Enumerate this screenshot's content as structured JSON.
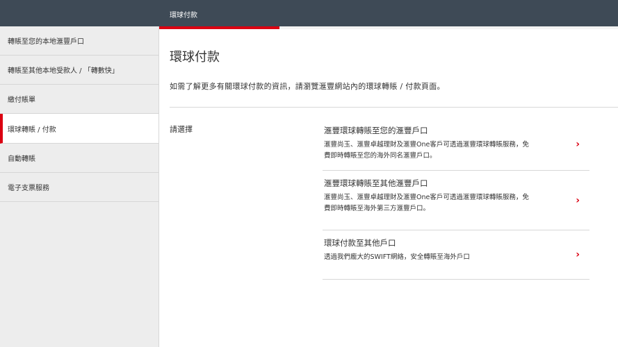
{
  "header": {
    "title": "環球付款"
  },
  "sidebar": {
    "items": [
      {
        "label": "轉賬至您的本地滙豐戶口"
      },
      {
        "label": "轉賬至其他本地受款人 / 「轉數快」"
      },
      {
        "label": "繳付賬單"
      },
      {
        "label": "環球轉賬 / 付款",
        "active": true
      },
      {
        "label": "自動轉賬"
      },
      {
        "label": "電子支票服務"
      }
    ]
  },
  "main": {
    "title": "環球付款",
    "intro": "如需了解更多有關環球付款的資訊，請瀏覽滙豐網站內的環球轉賬 / 付款頁面。",
    "choose_label": "請選擇",
    "options": [
      {
        "title": "滙豐環球轉賬至您的滙豐戶口",
        "desc_line1": "滙豐尚玉、滙豐卓越理財及滙豐One客戶可透過滙豐環球轉賬服務，免",
        "desc_line2": "費即時轉賬至您的海外同名滙豐戶口。"
      },
      {
        "title": "滙豐環球轉賬至其他滙豐戶口",
        "desc_line1": "滙豐尚玉、滙豐卓越理財及滙豐One客戶可透過滙豐環球轉賬服務，免",
        "desc_line2": "費即時轉賬至海外第三方滙豐戶口。"
      },
      {
        "title": "環球付款至其他戶口",
        "desc_line1": "透過我們龐大的SWIFT網絡，安全轉賬至海外戶口",
        "desc_line2": ""
      }
    ]
  },
  "colors": {
    "header_bg": "#3e4a56",
    "accent": "#db0011",
    "sidebar_bg": "#ededed"
  },
  "icons": {
    "option_arrow": "chevron-right-icon"
  }
}
